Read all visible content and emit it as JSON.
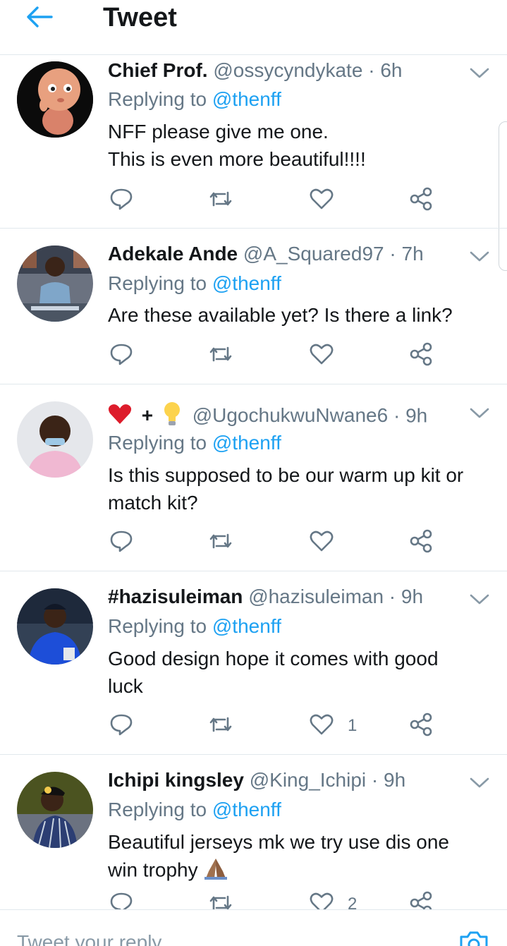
{
  "header": {
    "title": "Tweet",
    "back_icon": "arrow-left-icon"
  },
  "colors": {
    "accent": "#1da1f2",
    "text": "#14171a",
    "muted": "#657786",
    "divider": "#e1e8ed"
  },
  "tweets": [
    {
      "name": "Chief Prof.",
      "handle": "@ossycyndykate",
      "sep": " · ",
      "time": "6h",
      "replying_prefix": "Replying to ",
      "replying_to": "@thenff",
      "text_lines": [
        "NFF please give me one.",
        "This is even more beautiful!!!!"
      ],
      "likes": ""
    },
    {
      "name": "Adekale Ande",
      "handle": "@A_Squared97",
      "sep": " · ",
      "time": "7h",
      "replying_prefix": "Replying to ",
      "replying_to": "@thenff",
      "text_lines": [
        "Are these available yet? Is there a link?"
      ],
      "likes": ""
    },
    {
      "name": "",
      "name_emojis": [
        "red-heart",
        "plus",
        "light-bulb"
      ],
      "name_plus": "+",
      "handle": "@UgochukwuNwane6",
      "sep": " · ",
      "time": "9h",
      "replying_prefix": "Replying to ",
      "replying_to": "@thenff",
      "text_lines": [
        "Is this supposed to be our warm up kit or",
        "match kit?"
      ],
      "likes": ""
    },
    {
      "name": "#hazisuleiman",
      "handle": "@hazisuleiman",
      "sep": " · ",
      "time": "9h",
      "replying_prefix": "Replying to ",
      "replying_to": "@thenff",
      "text_lines": [
        "Good design hope it comes with good",
        "luck"
      ],
      "likes": "1"
    },
    {
      "name": "Ichipi kingsley",
      "handle": "@King_Ichipi",
      "sep": " · ",
      "time": "9h",
      "replying_prefix": "Replying to ",
      "replying_to": "@thenff",
      "text_lines": [
        "Beautiful jerseys mk we try use dis one",
        "win trophy"
      ],
      "text_emoji": "folded-hands",
      "likes": "2"
    }
  ],
  "action_icons": [
    "reply-icon",
    "retweet-icon",
    "like-icon",
    "share-icon"
  ],
  "compose": {
    "placeholder": "Tweet your reply",
    "camera_icon": "camera-icon"
  }
}
